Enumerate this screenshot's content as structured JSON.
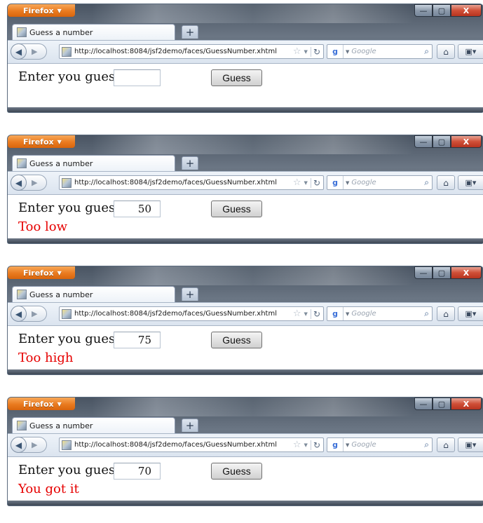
{
  "browser": {
    "menu_label": "Firefox",
    "tab_title": "Guess a number",
    "new_tab_label": "+",
    "url": "http://localhost:8084/jsf2demo/faces/GuessNumber.xhtml",
    "search_placeholder": "Google",
    "win_minimize": "—",
    "win_maximize": "▢",
    "win_close": "X"
  },
  "page": {
    "prompt": "Enter you guess:",
    "button_label": "Guess"
  },
  "frames": [
    {
      "input_value": "",
      "result": ""
    },
    {
      "input_value": "50",
      "result": "Too low"
    },
    {
      "input_value": "75",
      "result": "Too high"
    },
    {
      "input_value": "70",
      "result": "You got it"
    }
  ],
  "colors": {
    "result_text": "#e60000",
    "firefox_button": "#e97a1f",
    "close_button": "#cf4f37"
  },
  "icons": {
    "back": "back-arrow-icon",
    "forward": "forward-arrow-icon",
    "favicon": "page-favicon-icon",
    "bookmark_star": "star-icon",
    "reload": "reload-icon",
    "search_engine": "google-icon",
    "search": "magnifier-icon",
    "home": "home-icon",
    "bookmarks": "bookmarks-icon"
  }
}
